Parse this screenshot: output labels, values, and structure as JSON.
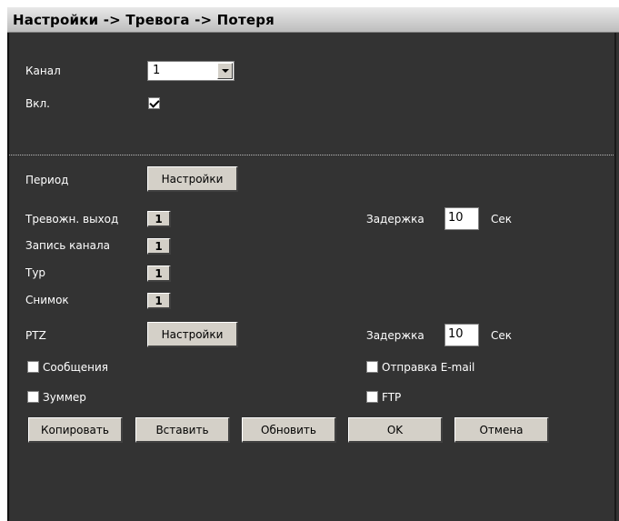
{
  "window": {
    "title": "Настройки -> Тревога -> Потеря"
  },
  "channel": {
    "label": "Канал",
    "value": "1"
  },
  "enable": {
    "label": "Вкл.",
    "checked": true
  },
  "period": {
    "label": "Период",
    "button": "Настройки"
  },
  "alarm_output": {
    "label": "Тревожн. выход",
    "value": "1"
  },
  "record_channel": {
    "label": "Запись канала",
    "value": "1"
  },
  "tour": {
    "label": "Тур",
    "value": "1"
  },
  "snapshot": {
    "label": "Снимок",
    "value": "1"
  },
  "ptz": {
    "label": "PTZ",
    "button": "Настройки"
  },
  "delay1": {
    "label": "Задержка",
    "value": "10",
    "unit": "Сек"
  },
  "delay2": {
    "label": "Задержка",
    "value": "10",
    "unit": "Сек"
  },
  "messages": {
    "label": "Сообщения",
    "checked": false
  },
  "buzzer": {
    "label": "Зуммер",
    "checked": false
  },
  "email": {
    "label": "Отправка E-mail",
    "checked": false
  },
  "ftp": {
    "label": "FTP",
    "checked": false
  },
  "buttons": {
    "copy": "Копировать",
    "paste": "Вставить",
    "refresh": "Обновить",
    "ok": "OK",
    "cancel": "Отмена"
  }
}
